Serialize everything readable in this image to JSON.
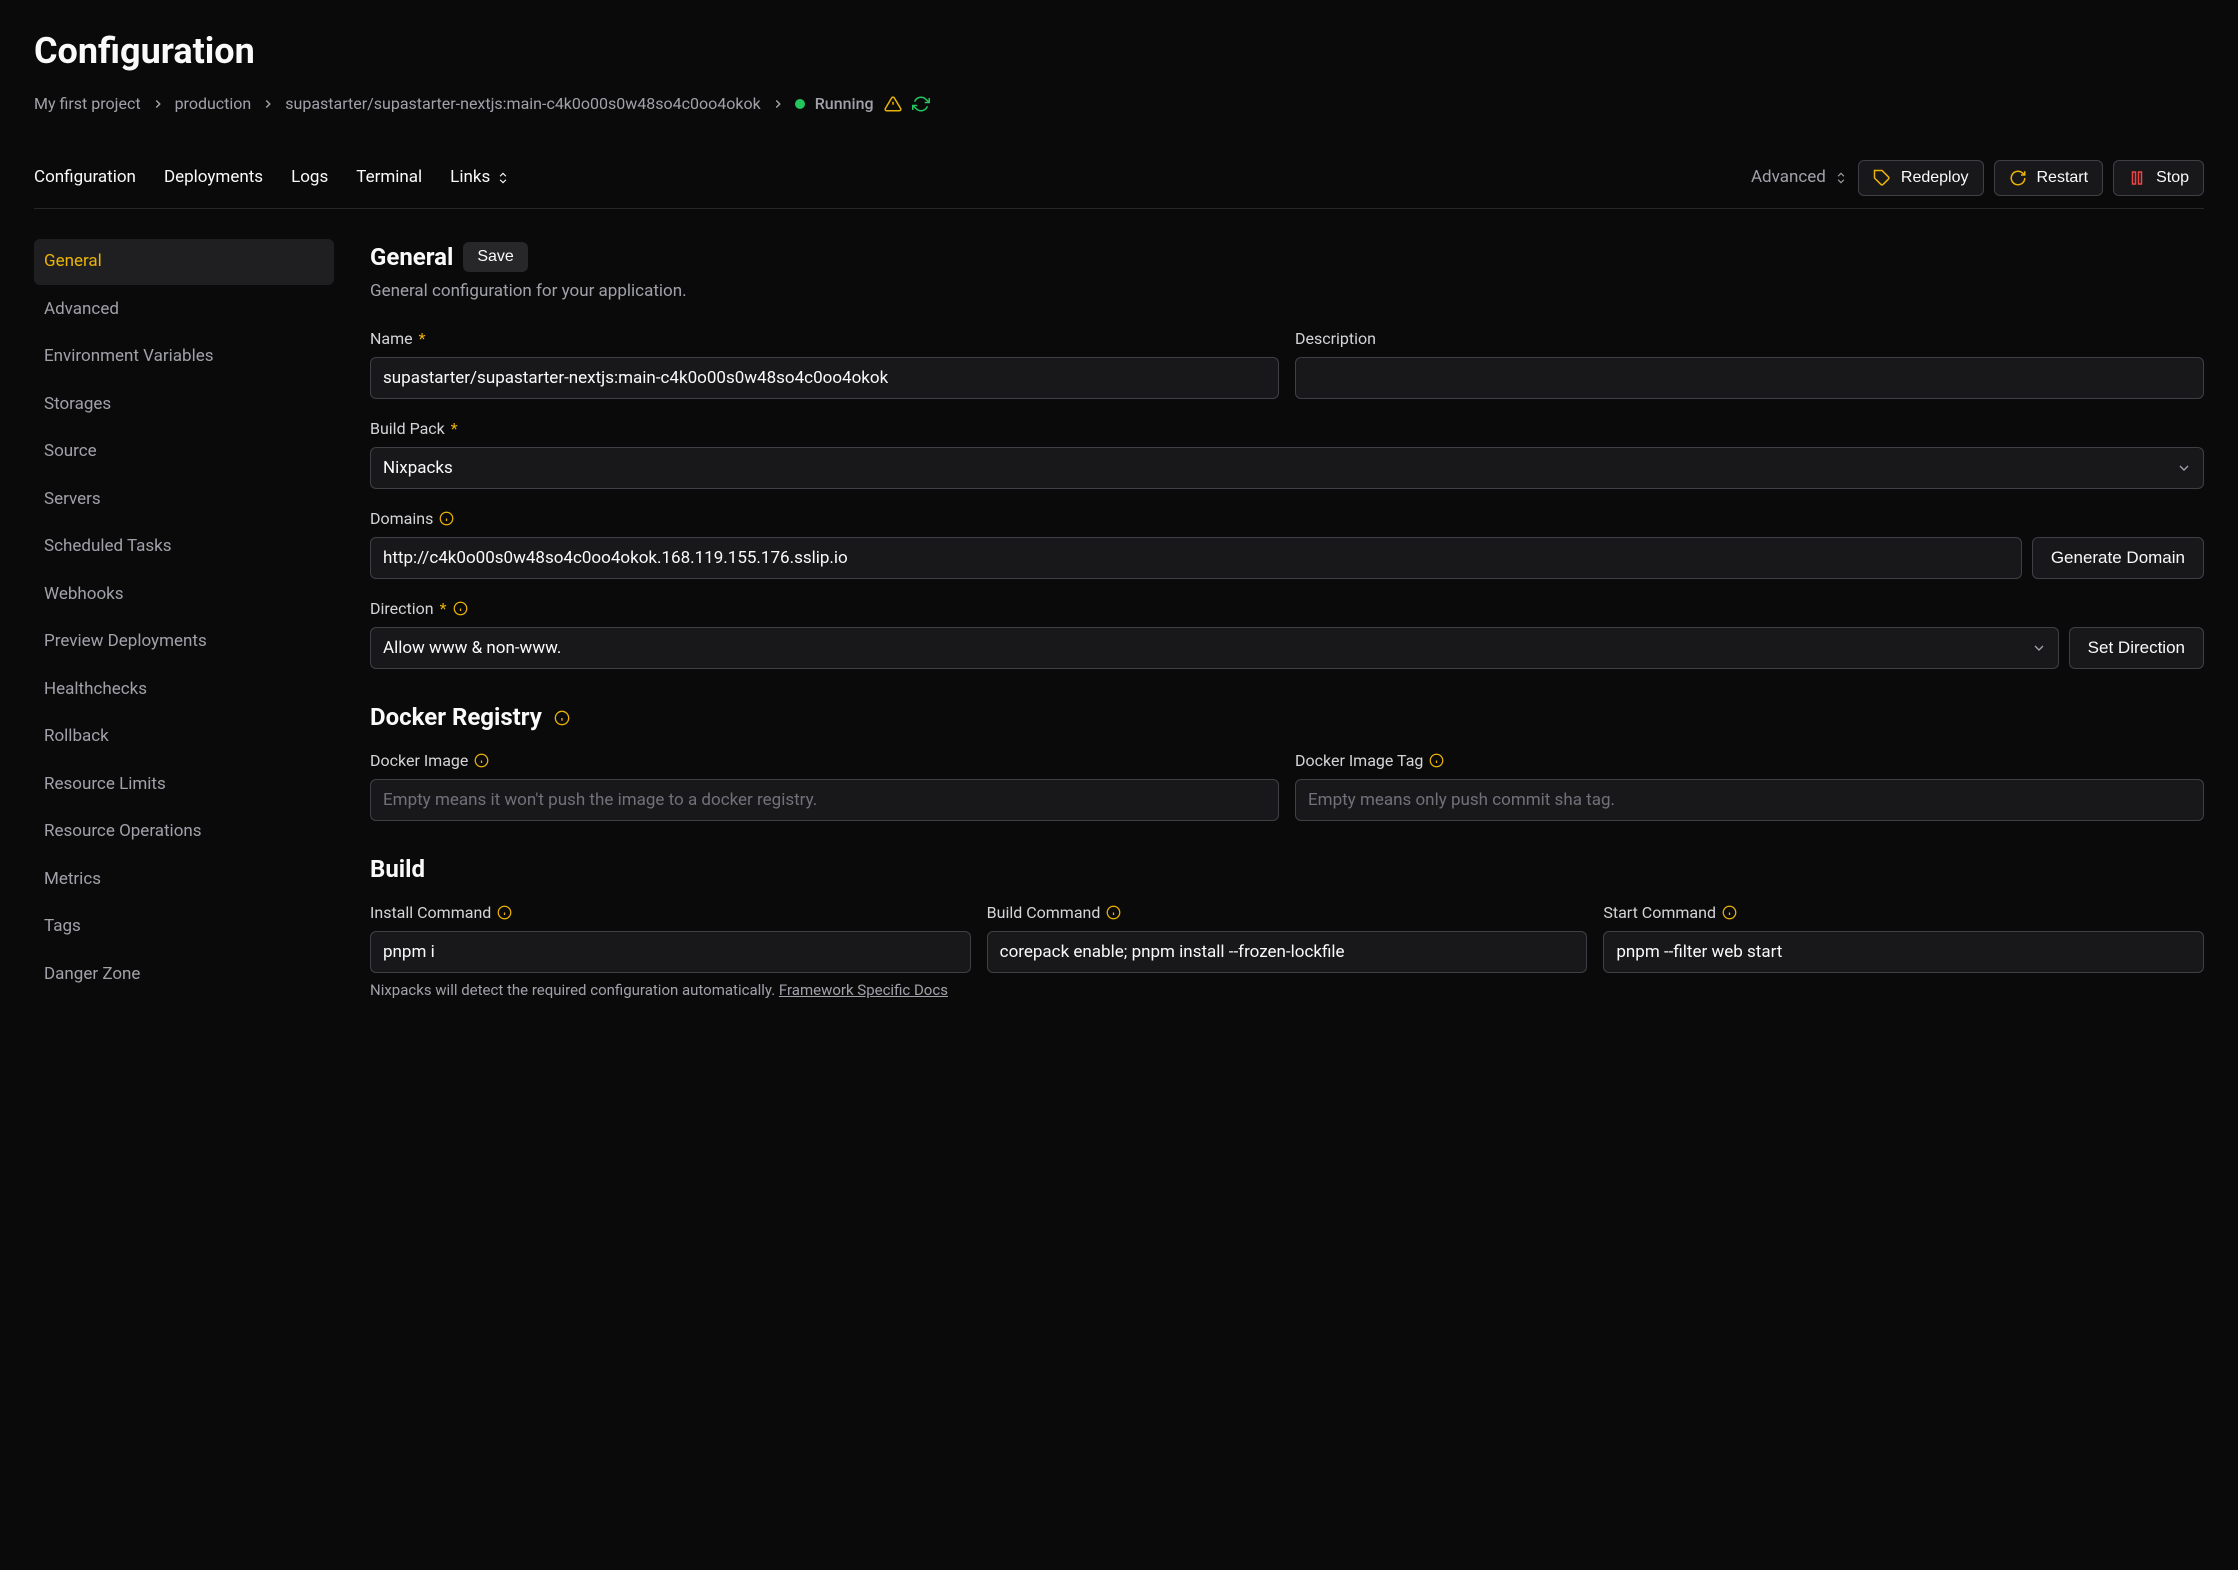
{
  "header": {
    "title": "Configuration"
  },
  "breadcrumb": {
    "items": [
      "My first project",
      "production",
      "supastarter/supastarter-nextjs:main-c4k0o00s0w48so4c0oo4okok"
    ],
    "status_label": "Running"
  },
  "tabs": {
    "config": "Configuration",
    "deployments": "Deployments",
    "logs": "Logs",
    "terminal": "Terminal",
    "links": "Links"
  },
  "topbar": {
    "advanced": "Advanced",
    "redeploy": "Redeploy",
    "restart": "Restart",
    "stop": "Stop"
  },
  "sidebar": {
    "items": [
      "General",
      "Advanced",
      "Environment Variables",
      "Storages",
      "Source",
      "Servers",
      "Scheduled Tasks",
      "Webhooks",
      "Preview Deployments",
      "Healthchecks",
      "Rollback",
      "Resource Limits",
      "Resource Operations",
      "Metrics",
      "Tags",
      "Danger Zone"
    ]
  },
  "general": {
    "title": "General",
    "save": "Save",
    "desc": "General configuration for your application.",
    "name_label": "Name",
    "name_value": "supastarter/supastarter-nextjs:main-c4k0o00s0w48so4c0oo4okok",
    "desc_label": "Description",
    "desc_value": "",
    "buildpack_label": "Build Pack",
    "buildpack_value": "Nixpacks",
    "domains_label": "Domains",
    "domains_value": "http://c4k0o00s0w48so4c0oo4okok.168.119.155.176.sslip.io",
    "generate_domain": "Generate Domain",
    "direction_label": "Direction",
    "direction_value": "Allow www & non-www.",
    "set_direction": "Set Direction"
  },
  "docker": {
    "title": "Docker Registry",
    "image_label": "Docker Image",
    "image_placeholder": "Empty means it won't push the image to a docker registry.",
    "tag_label": "Docker Image Tag",
    "tag_placeholder": "Empty means only push commit sha tag."
  },
  "build": {
    "title": "Build",
    "install_label": "Install Command",
    "install_value": "pnpm i",
    "build_label": "Build Command",
    "build_value": "corepack enable; pnpm install --frozen-lockfile",
    "start_label": "Start Command",
    "start_value": "pnpm --filter web start",
    "hint_text": "Nixpacks will detect the required configuration automatically. ",
    "hint_link": "Framework Specific Docs"
  }
}
